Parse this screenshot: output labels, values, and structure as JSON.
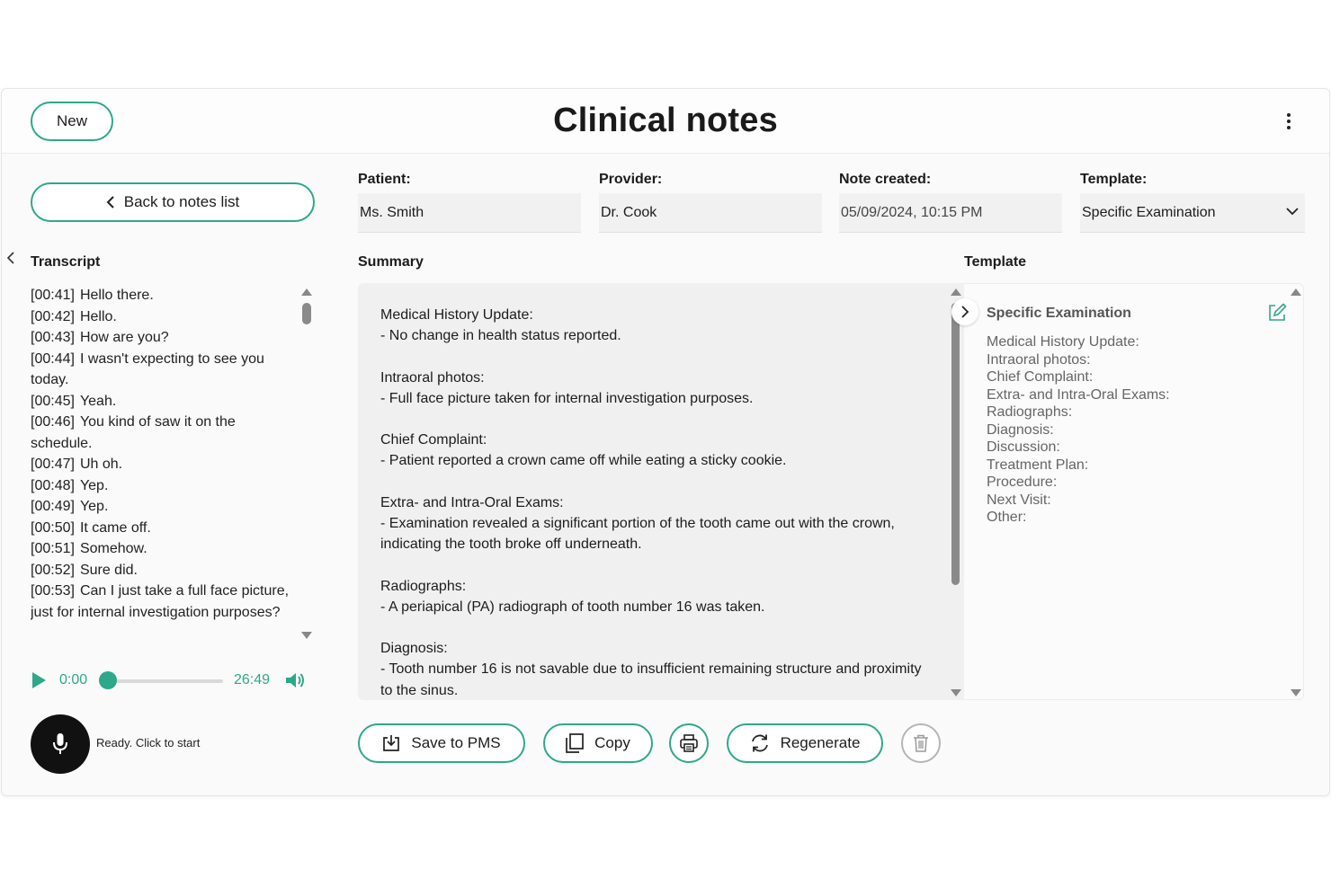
{
  "header": {
    "new_label": "New",
    "title": "Clinical notes",
    "menu_icon": "kebab-menu-icon"
  },
  "sidebar": {
    "back_label": "Back to notes list",
    "transcript_heading": "Transcript",
    "transcript": [
      {
        "ts": "[00:41]",
        "text": "Hello there."
      },
      {
        "ts": "[00:42]",
        "text": "Hello."
      },
      {
        "ts": "[00:43]",
        "text": "How are you?"
      },
      {
        "ts": "[00:44]",
        "text": "I wasn't expecting to see you today."
      },
      {
        "ts": "[00:45]",
        "text": "Yeah."
      },
      {
        "ts": "[00:46]",
        "text": "You kind of saw it on the schedule."
      },
      {
        "ts": "[00:47]",
        "text": "Uh oh."
      },
      {
        "ts": "[00:48]",
        "text": "Yep."
      },
      {
        "ts": "[00:49]",
        "text": "Yep."
      },
      {
        "ts": "[00:50]",
        "text": "It came off."
      },
      {
        "ts": "[00:51]",
        "text": "Somehow."
      },
      {
        "ts": "[00:52]",
        "text": "Sure did."
      },
      {
        "ts": "[00:53]",
        "text": "Can I just take a full face picture, just for internal investigation purposes?"
      }
    ],
    "player": {
      "current": "0:00",
      "total": "26:49",
      "progress_fraction": 0.0
    },
    "mic_status": "Ready. Click to start"
  },
  "fields": {
    "patient": {
      "label": "Patient:",
      "value": "Ms. Smith"
    },
    "provider": {
      "label": "Provider:",
      "value": "Dr. Cook"
    },
    "note_created": {
      "label": "Note created:",
      "value": "05/09/2024, 10:15 PM"
    },
    "template": {
      "label": "Template:",
      "value": "Specific Examination"
    }
  },
  "summary": {
    "heading": "Summary",
    "sections": [
      {
        "title": "Medical History Update:",
        "body": "- No change in health status reported."
      },
      {
        "title": "Intraoral photos:",
        "body": "- Full face picture taken for internal investigation purposes."
      },
      {
        "title": "Chief Complaint:",
        "body": "- Patient reported a crown came off while eating a sticky cookie."
      },
      {
        "title": "Extra- and Intra-Oral Exams:",
        "body": "- Examination revealed a significant portion of the tooth came out with the crown, indicating the tooth broke off underneath."
      },
      {
        "title": "Radiographs:",
        "body": "- A periapical (PA) radiograph of tooth number 16 was taken."
      },
      {
        "title": "Diagnosis:",
        "body": "- Tooth number 16 is not savable due to insufficient remaining structure and proximity to the sinus."
      }
    ]
  },
  "template_panel": {
    "heading": "Template",
    "title": "Specific Examination",
    "lines": [
      "Medical History Update:",
      "Intraoral photos:",
      "Chief Complaint:",
      "Extra- and Intra-Oral Exams:",
      "Radiographs:",
      "Diagnosis:",
      "Discussion:",
      "Treatment Plan:",
      "Procedure:",
      "Next Visit:",
      "Other:"
    ]
  },
  "actions": {
    "save_label": "Save to PMS",
    "copy_label": "Copy",
    "regenerate_label": "Regenerate"
  },
  "colors": {
    "accent": "#2ea88a",
    "mic_button": "#111111",
    "disabled": "#b5b5b5"
  }
}
